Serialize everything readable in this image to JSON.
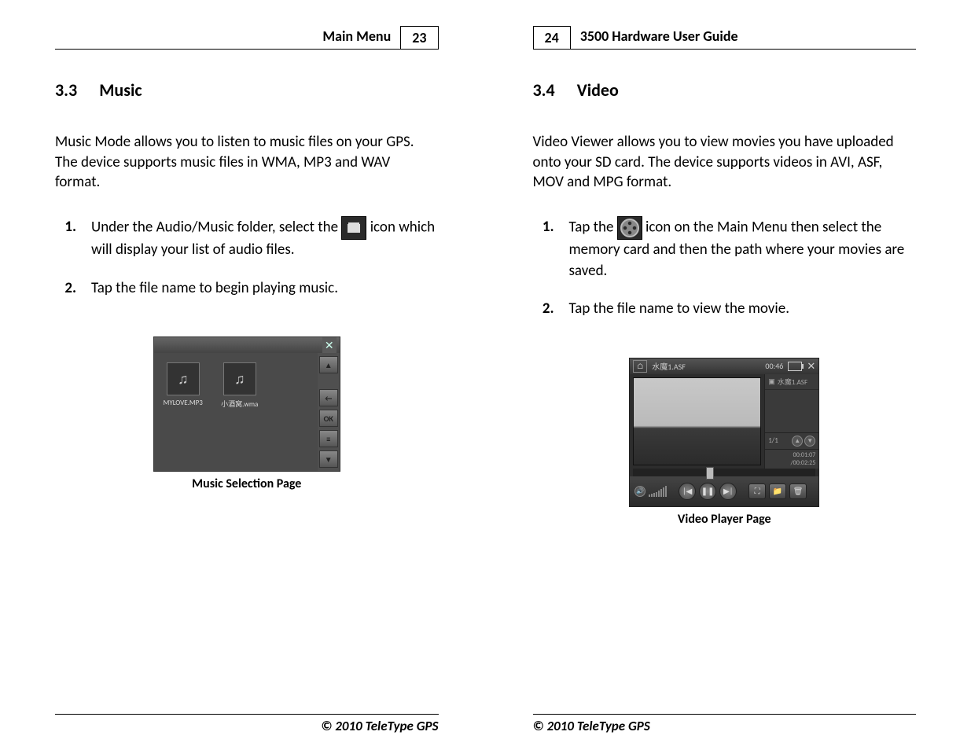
{
  "left": {
    "header_title": "Main Menu",
    "page_number": "23",
    "section_number": "3.3",
    "section_title": "Music",
    "intro": "Music Mode allows you to listen to music files on your GPS. The device supports music files in WMA, MP3 and WAV format.",
    "step1_a": "Under the Audio/Music folder, select the ",
    "step1_b": " icon which will display your list of audio files.",
    "step2": "Tap the file name to begin playing music.",
    "figure": {
      "caption": "Music Selection Page",
      "file1": "MYLOVE.MP3",
      "file2": "小酒窝.wma",
      "ok_label": "OK"
    },
    "footer": "© 2010 TeleType GPS"
  },
  "right": {
    "header_title": "3500 Hardware User Guide",
    "page_number": "24",
    "section_number": "3.4",
    "section_title": "Video",
    "intro": "Video Viewer allows you to view movies you have uploaded onto your SD card. The device supports videos in AVI, ASF, MOV and MPG format.",
    "step1_a": "Tap the ",
    "step1_b": " icon on the Main Menu then select the memory card and then the path where your movies are saved.",
    "step2": "Tap the file name to view the movie.",
    "figure": {
      "caption": "Video Player Page",
      "title": "水魔1.ASF",
      "clock": "00:46",
      "list_item": "水魔1.ASF",
      "page_indicator": "1/1",
      "timecode": "00:01:07 /00:02:25"
    },
    "footer": "© 2010 TeleType GPS"
  }
}
